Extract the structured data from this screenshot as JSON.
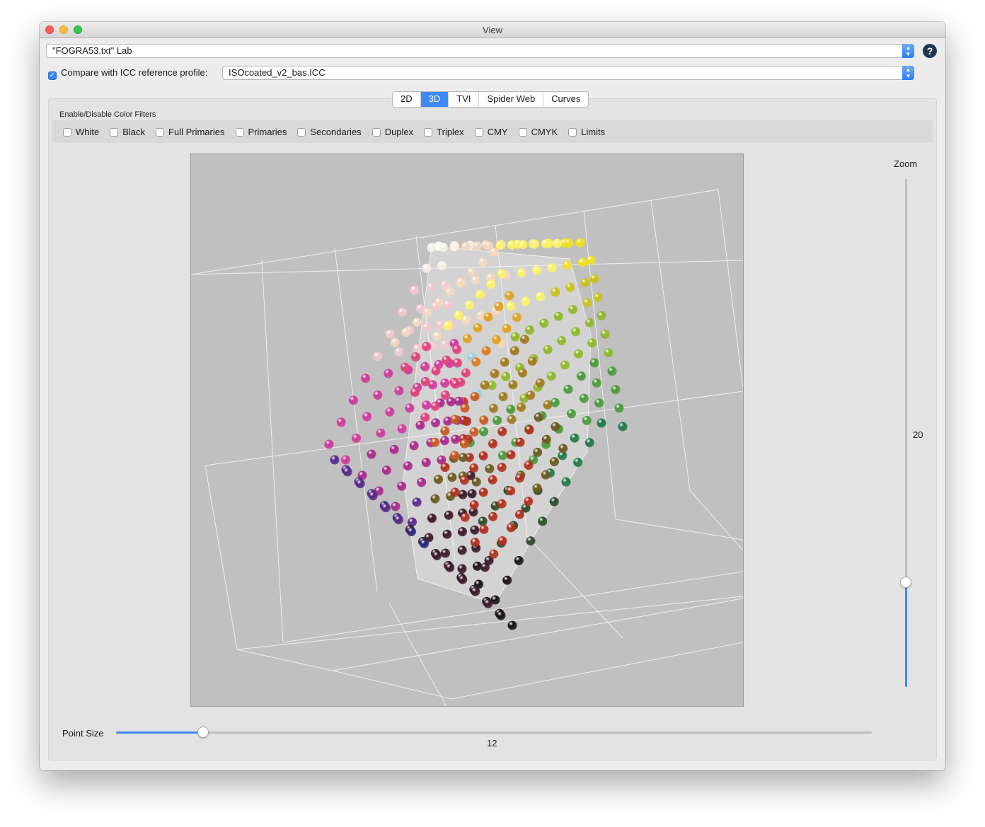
{
  "window": {
    "title": "View"
  },
  "dataset_select": {
    "value": "\"FOGRA53.txt\" Lab"
  },
  "help_button": {
    "label": "?"
  },
  "compare": {
    "checked": true,
    "label": "Compare with ICC reference profile:",
    "profile": "ISOcoated_v2_bas.ICC"
  },
  "tabs": [
    {
      "label": "2D",
      "active": false
    },
    {
      "label": "3D",
      "active": true
    },
    {
      "label": "TVI",
      "active": false
    },
    {
      "label": "Spider Web",
      "active": false
    },
    {
      "label": "Curves",
      "active": false
    }
  ],
  "filters": {
    "title": "Enable/Disable Color Filters",
    "items": [
      {
        "label": "White",
        "checked": false
      },
      {
        "label": "Black",
        "checked": false
      },
      {
        "label": "Full Primaries",
        "checked": false
      },
      {
        "label": "Primaries",
        "checked": false
      },
      {
        "label": "Secondaries",
        "checked": false
      },
      {
        "label": "Duplex",
        "checked": false
      },
      {
        "label": "Triplex",
        "checked": false
      },
      {
        "label": "CMY",
        "checked": false
      },
      {
        "label": "CMYK",
        "checked": false
      },
      {
        "label": "Limits",
        "checked": false
      }
    ]
  },
  "zoom": {
    "label": "Zoom",
    "value": "20",
    "fraction": 0.2
  },
  "point_size": {
    "label": "Point Size",
    "value": "12",
    "fraction": 0.117
  },
  "colors": {
    "accent": "#3d8af7",
    "viewport_bg": "#c0c0c0",
    "sphere_palette": [
      "#fbf26a",
      "#f0e020",
      "#c9c21a",
      "#8fb82a",
      "#4a9a3a",
      "#1f7a4a",
      "#2d4a2a",
      "#6a5a20",
      "#a07a20",
      "#e0a020",
      "#e07a20",
      "#c85a20",
      "#b03020",
      "#d02a3a",
      "#e0407a",
      "#d03a9a",
      "#a82a8a",
      "#5a2a8a",
      "#2a2a7a",
      "#3a1a2a",
      "#1a1414",
      "#f0c8d0",
      "#f4d8c0",
      "#9ad0e0",
      "#f8f0e8",
      "#ffffff"
    ]
  }
}
